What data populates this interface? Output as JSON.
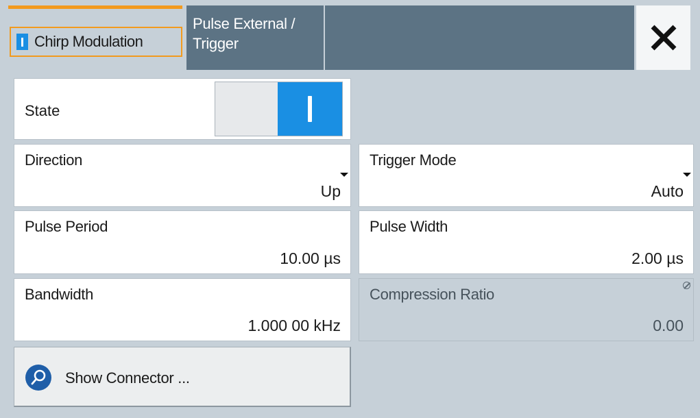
{
  "tabs": {
    "active_label": "Chirp Modulation",
    "second_label_line1": "Pulse External /",
    "second_label_line2": "Trigger"
  },
  "close": {
    "icon": "close-icon"
  },
  "state": {
    "label": "State",
    "value": "I"
  },
  "direction": {
    "label": "Direction",
    "value": "Up"
  },
  "trigger_mode": {
    "label": "Trigger Mode",
    "value": "Auto"
  },
  "pulse_period": {
    "label": "Pulse Period",
    "value": "10.00 µs"
  },
  "pulse_width": {
    "label": "Pulse Width",
    "value": "2.00 µs"
  },
  "bandwidth": {
    "label": "Bandwidth",
    "value": "1.000 00 kHz"
  },
  "compression_ratio": {
    "label": "Compression Ratio",
    "value": "0.00"
  },
  "show_connector": {
    "label": "Show Connector ...",
    "icon": "search-icon"
  },
  "colors": {
    "accent": "#f29a1e",
    "toggle_on": "#1a8fe3",
    "tab_bg": "#5c7384",
    "panel_bg": "#c6d0d8"
  }
}
